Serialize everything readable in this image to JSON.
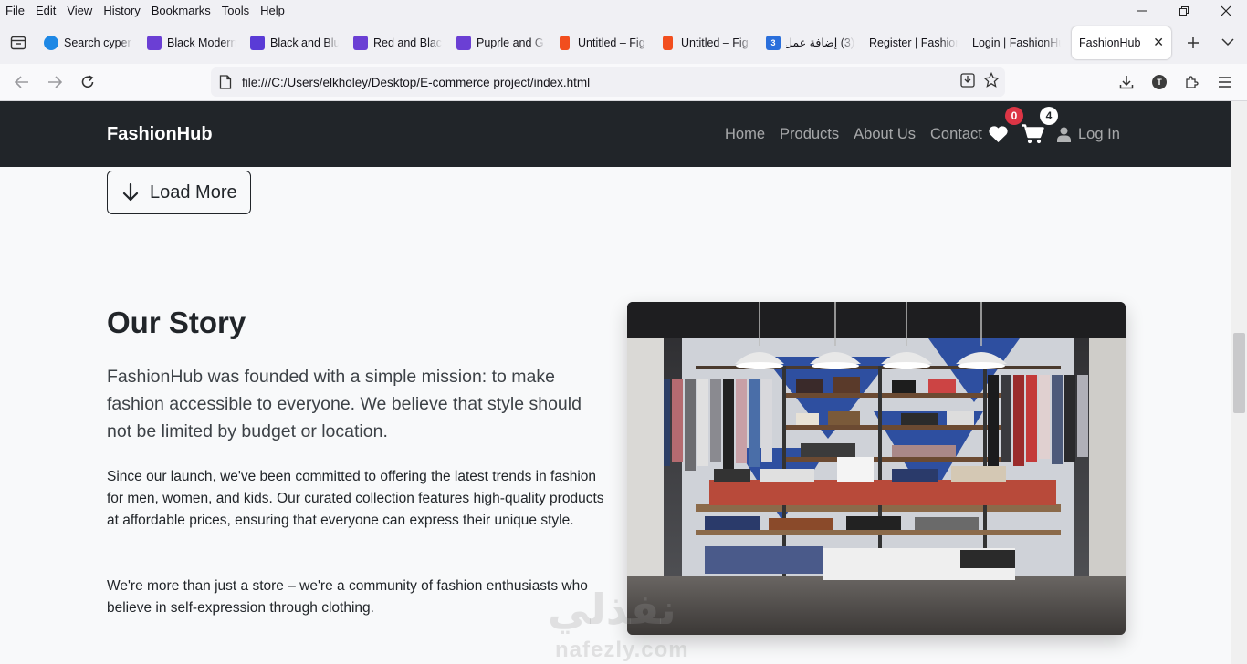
{
  "menu": [
    "File",
    "Edit",
    "View",
    "History",
    "Bookmarks",
    "Tools",
    "Help"
  ],
  "tabs": [
    {
      "label": "Search cyper",
      "icon": "copilot-icon",
      "color": "#1e88e5"
    },
    {
      "label": "Black Modern",
      "icon": "canva-icon",
      "color": "#6b3fd4"
    },
    {
      "label": "Black and Blu",
      "icon": "video-icon",
      "color": "#5a3bd6"
    },
    {
      "label": "Red and Blac",
      "icon": "canva-icon",
      "color": "#6b3fd4"
    },
    {
      "label": "Puprle and G",
      "icon": "canva-icon",
      "color": "#6b3fd4"
    },
    {
      "label": "Untitled – Fig",
      "icon": "figma-icon",
      "color": "#f24e1e"
    },
    {
      "label": "Untitled – Fig",
      "icon": "figma-icon",
      "color": "#f24e1e"
    },
    {
      "label": "(3) إضافة عمل",
      "icon": "mostaql-icon",
      "color": "#2a6fdb",
      "badge": "3"
    },
    {
      "label": "Register | Fashion",
      "icon": "",
      "color": ""
    },
    {
      "label": "Login | FashionHu",
      "icon": "",
      "color": ""
    }
  ],
  "active_tab": {
    "label": "FashionHub",
    "close": "✕"
  },
  "url": "file:///C:/Users/elkholey/Desktop/E-commerce project/index.html",
  "account_initial": "T",
  "site": {
    "brand": "FashionHub",
    "nav": [
      "Home",
      "Products",
      "About Us",
      "Contact"
    ],
    "wishlist_count": "0",
    "cart_count": "4",
    "login": "Log In",
    "load_more": "Load More"
  },
  "story": {
    "title": "Our Story",
    "lead": "FashionHub was founded with a simple mission: to make fashion accessible to everyone. We believe that style should not be limited by budget or location.",
    "p1": "Since our launch, we've been committed to offering the latest trends in fashion for men, women, and kids. Our curated collection features high-quality products at affordable prices, ensuring that everyone can express their unique style.",
    "p2": "We're more than just a store – we're a community of fashion enthusiasts who believe in self-expression through clothing."
  },
  "watermark": {
    "arabic": "نفذلي",
    "latin": "nafezly.com"
  },
  "colors": {
    "nav_bg": "#212529",
    "badge_red": "#dc3545",
    "page_bg": "#f8f9fa"
  }
}
